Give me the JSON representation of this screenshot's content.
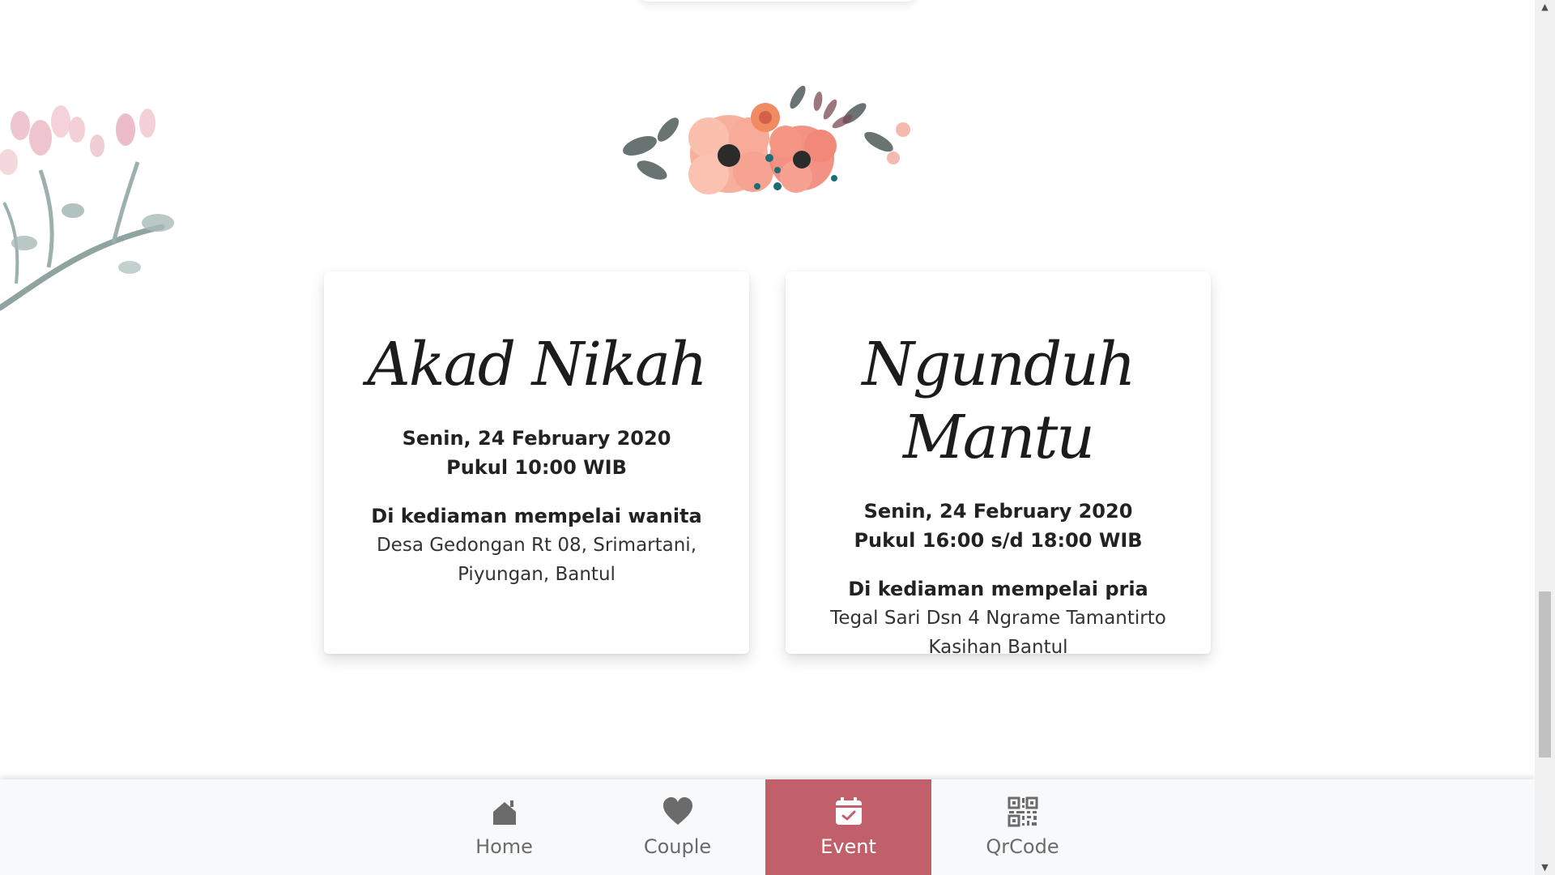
{
  "events": [
    {
      "title": "Akad Nikah",
      "date": "Senin, 24 February 2020",
      "time": "Pukul 10:00 WIB",
      "place_title": "Di kediaman mempelai wanita",
      "address_line1": "Desa Gedongan Rt 08, Srimartani,",
      "address_line2": "Piyungan, Bantul"
    },
    {
      "title": "Ngunduh Mantu",
      "date": "Senin, 24 February 2020",
      "time": "Pukul 16:00 s/d 18:00 WIB",
      "place_title": "Di kediaman mempelai pria",
      "address_line1": "Tegal Sari Dsn 4 Ngrame Tamantirto",
      "address_line2": "Kasihan Bantul"
    }
  ],
  "nav": {
    "items": [
      {
        "label": "Home",
        "icon": "home-icon"
      },
      {
        "label": "Couple",
        "icon": "heart-icon"
      },
      {
        "label": "Event",
        "icon": "calendar-check-icon",
        "active": true
      },
      {
        "label": "QrCode",
        "icon": "qrcode-icon"
      }
    ]
  },
  "colors": {
    "accent": "#c1606b",
    "nav_bg": "#f8f9fa",
    "nav_text": "#6b6b6b"
  }
}
